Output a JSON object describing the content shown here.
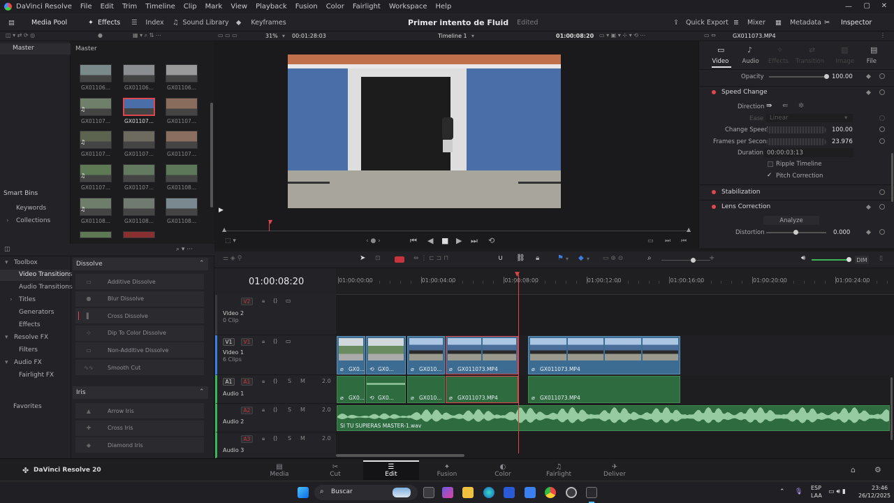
{
  "app": {
    "title": "DaVinci Resolve",
    "menus": [
      "File",
      "Edit",
      "Trim",
      "Timeline",
      "Clip",
      "Mark",
      "View",
      "Playback",
      "Fusion",
      "Color",
      "Fairlight",
      "Workspace",
      "Help"
    ],
    "brand": "DaVinci Resolve 20"
  },
  "modbar": {
    "media_pool": "Media Pool",
    "effects": "Effects",
    "index": "Index",
    "sound_library": "Sound Library",
    "keyframes": "Keyframes",
    "project_title": "Primer intento de Fluid",
    "project_status": "Edited",
    "quick_export": "Quick Export",
    "mixer": "Mixer",
    "metadata": "Metadata",
    "inspector": "Inspector"
  },
  "viewerbar": {
    "zoom": "31%",
    "source_tc": "00:01:28:03",
    "timeline_name": "Timeline 1",
    "record_tc": "01:00:08:20",
    "inspector_clip": "GX011073.MP4"
  },
  "mediapool": {
    "folder_master": "Master",
    "bin_header": "Master",
    "smart_bins": "Smart Bins",
    "keywords": "Keywords",
    "collections": "Collections",
    "clips": [
      "GX01106...",
      "GX01106...",
      "GX01106...",
      "GX01107...",
      "GX01107...",
      "GX01107...",
      "GX01107...",
      "GX01107...",
      "GX01107...",
      "GX01107...",
      "GX01107...",
      "GX01108...",
      "GX01108...",
      "GX01108...",
      "GX01108..."
    ]
  },
  "toolbox": {
    "items": [
      "Toolbox",
      "Video Transitions",
      "Audio Transitions",
      "Titles",
      "Generators",
      "Effects",
      "Resolve FX",
      "Filters",
      "Audio FX",
      "Fairlight FX"
    ],
    "favorites": "Favorites",
    "dissolve_header": "Dissolve",
    "dissolve": [
      "Additive Dissolve",
      "Blur Dissolve",
      "Cross Dissolve",
      "Dip To Color Dissolve",
      "Non-Additive Dissolve",
      "Smooth Cut"
    ],
    "iris_header": "Iris",
    "iris": [
      "Arrow Iris",
      "Cross Iris",
      "Diamond Iris"
    ]
  },
  "inspector": {
    "tabs": [
      "Video",
      "Audio",
      "Effects",
      "Transition",
      "Image",
      "File"
    ],
    "opacity_label": "Opacity",
    "opacity_value": "100.00",
    "speed_change": "Speed Change",
    "direction": "Direction",
    "ease_label": "Ease",
    "ease_value": "Linear",
    "change_speed": "Change Speed",
    "change_speed_value": "100.00",
    "fps_label": "Frames per Second",
    "fps_value": "23.976",
    "duration_label": "Duration",
    "duration_value": "00:00:03:13",
    "ripple": "Ripple Timeline",
    "pitch": "Pitch Correction",
    "stabilization": "Stabilization",
    "lens_correction": "Lens Correction",
    "analyze": "Analyze",
    "distortion": "Distortion",
    "distortion_value": "0.000"
  },
  "timeline": {
    "timecode": "01:00:08:20",
    "ruler": [
      "01:00:00:00",
      "01:00:04:00",
      "01:00:08:00",
      "01:00:12:00",
      "01:00:16:00",
      "01:00:20:00",
      "01:00:24:00"
    ],
    "tracks": {
      "v2": {
        "tag": "V2",
        "name": "Video 2",
        "info": "0 Clip"
      },
      "v1": {
        "tag1": "V1",
        "tag2": "V1",
        "name": "Video 1",
        "info": "6 Clips"
      },
      "a1": {
        "tag1": "A1",
        "tag2": "A1",
        "name": "Audio 1",
        "level": "2.0"
      },
      "a2": {
        "tag": "A2",
        "name": "Audio 2",
        "level": "2.0"
      },
      "a3": {
        "tag": "A3",
        "name": "Audio 3",
        "level": "2.0"
      }
    },
    "v_clips": [
      "GX0...",
      "GX0...",
      "GX010...",
      "GX011073.MP4",
      "GX011073.MP4"
    ],
    "a_clips": [
      "GX0...",
      "GX0...",
      "GX010...",
      "GX011073.MP4",
      "GX011073.MP4"
    ],
    "music_clip": "SI TU SUPIERAS MASTER-1.wav",
    "s_label": "S",
    "m_label": "M",
    "dim": "DIM"
  },
  "pages": [
    "Media",
    "Cut",
    "Edit",
    "Fusion",
    "Color",
    "Fairlight",
    "Deliver"
  ],
  "taskbar": {
    "search": "Buscar",
    "lang1": "ESP",
    "lang2": "LAA",
    "time": "23:46",
    "date": "26/12/2025"
  },
  "colors": {
    "accent": "#e0464e",
    "video_clip": "#3c6c91",
    "audio_clip": "#2e6b3e",
    "playhead": "#e0464e"
  }
}
